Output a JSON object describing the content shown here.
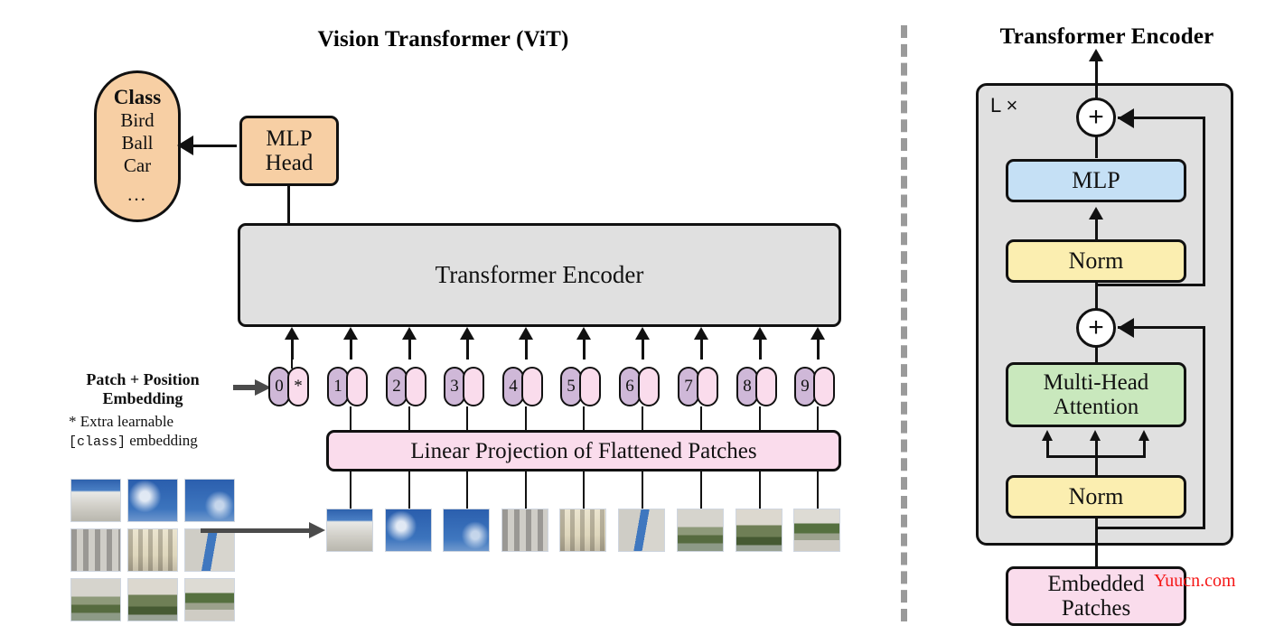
{
  "diagram": {
    "left_title": "Vision Transformer (ViT)",
    "right_title": "Transformer Encoder"
  },
  "class_head": {
    "title": "Class",
    "items": [
      "Bird",
      "Ball",
      "Car"
    ],
    "ellipsis": "...",
    "color": "#f7cfa4"
  },
  "mlp_head": {
    "line1": "MLP",
    "line2": "Head",
    "color": "#f7cfa4"
  },
  "encoder_block": {
    "label": "Transformer Encoder",
    "color": "#e0e0e0"
  },
  "embedding": {
    "label_line1": "Patch + Position",
    "label_line2": "Embedding",
    "note_line1_prefix": "* Extra learnable",
    "note_line2_mono": "[class]",
    "note_line2_rest": " embedding",
    "class_token_number": "0",
    "class_token_star": "*",
    "position_numbers": [
      "1",
      "2",
      "3",
      "4",
      "5",
      "6",
      "7",
      "8",
      "9"
    ],
    "position_color": "#cfb8d8",
    "patch_color": "#fadcec"
  },
  "linear_projection": {
    "label": "Linear Projection of Flattened Patches",
    "color": "#fadcec"
  },
  "encoder_detail": {
    "repeat_label": "L ×",
    "panel_color": "#e0e0e0",
    "plus_symbol": "+",
    "mlp": {
      "label": "MLP",
      "color": "#c5e0f5"
    },
    "norm_top": {
      "label": "Norm",
      "color": "#fbeeb0"
    },
    "attention": {
      "line1": "Multi-Head",
      "line2": "Attention",
      "color": "#c9e8bd"
    },
    "norm_bottom": {
      "label": "Norm",
      "color": "#fbeeb0"
    },
    "embedded_patches": {
      "line1": "Embedded",
      "line2": "Patches",
      "color": "#fadcec"
    }
  },
  "watermark": {
    "text": "Yuucn.com",
    "color": "#f51616"
  }
}
